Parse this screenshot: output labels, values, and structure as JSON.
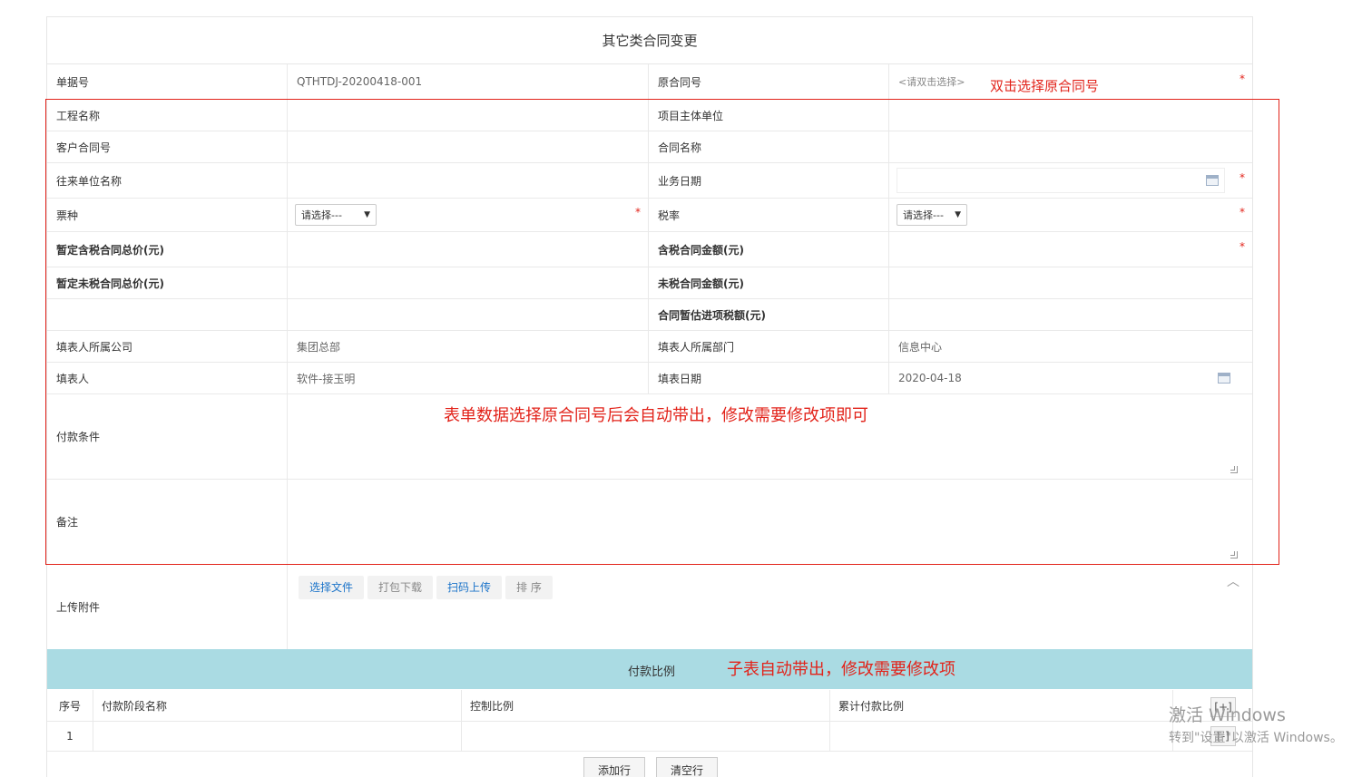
{
  "form": {
    "title": "其它类合同变更",
    "doc_no_label": "单据号",
    "doc_no_value": "QTHTDJ-20200418-001",
    "orig_contract_label": "原合同号",
    "orig_contract_placeholder": "<请双击选择>",
    "project_name_label": "工程名称",
    "project_owner_label": "项目主体单位",
    "customer_contract_label": "客户合同号",
    "contract_name_label": "合同名称",
    "partner_name_label": "往来单位名称",
    "business_date_label": "业务日期",
    "ticket_type_label": "票种",
    "ticket_type_value": "请选择---",
    "tax_rate_label": "税率",
    "tax_rate_value": "请选择---",
    "provisional_incl_label": "暂定含税合同总价(元)",
    "incl_amount_label": "含税合同金额(元)",
    "provisional_excl_label": "暂定未税合同总价(元)",
    "excl_amount_label": "未税合同金额(元)",
    "est_tax_label": "合同暂估进项税额(元)",
    "filler_company_label": "填表人所属公司",
    "filler_company_value": "集团总部",
    "filler_dept_label": "填表人所属部门",
    "filler_dept_value": "信息中心",
    "filler_label": "填表人",
    "filler_value": "软件-接玉明",
    "fill_date_label": "填表日期",
    "fill_date_value": "2020-04-18",
    "payment_terms_label": "付款条件",
    "remarks_label": "备注",
    "attachment_label": "上传附件",
    "required_mark": "*"
  },
  "upload": {
    "select_file": "选择文件",
    "pack_download": "打包下载",
    "scan_upload": "扫码上传",
    "sort": "排 序",
    "collapse_glyph": "︿"
  },
  "subtable": {
    "title": "付款比例",
    "col_seq": "序号",
    "col_stage": "付款阶段名称",
    "col_ratio": "控制比例",
    "col_cumulative": "累计付款比例",
    "row1_seq": "1",
    "plus": "[+]",
    "minus": "[-]",
    "add_row": "添加行",
    "clear_row": "清空行"
  },
  "annotations": {
    "dblclick_hint": "双击选择原合同号",
    "auto_fill_hint": "表单数据选择原合同号后会自动带出，修改需要修改项即可",
    "subtable_hint": "子表自动带出，修改需要修改项"
  },
  "watermark": {
    "line1": "激活 Windows",
    "line2": "转到\"设置\"以激活 Windows。"
  },
  "colors": {
    "accent_red": "#e2231a",
    "band_bg": "#aadbe3",
    "link_blue": "#1a73c9"
  }
}
